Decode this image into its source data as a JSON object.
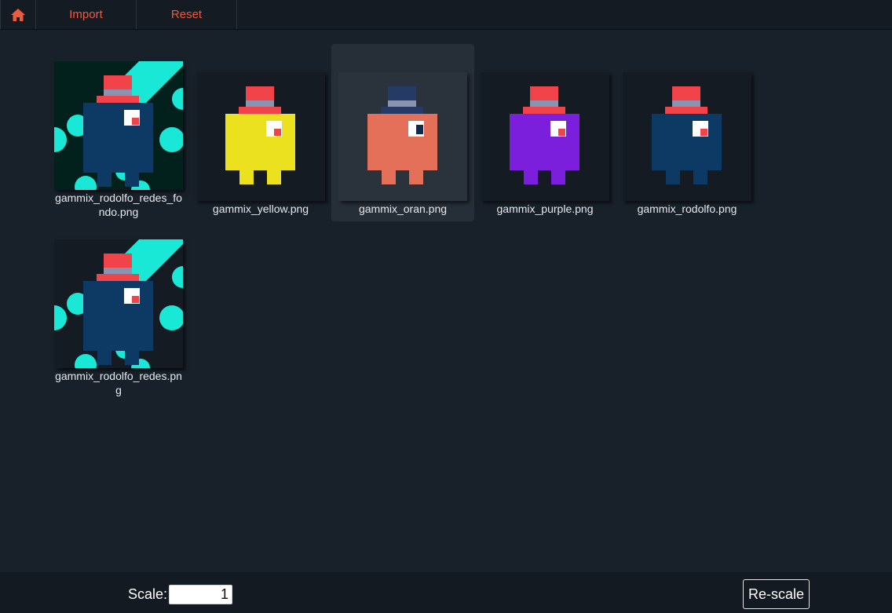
{
  "toolbar": {
    "home_icon": "home-icon",
    "import_label": "Import",
    "reset_label": "Reset",
    "accent_color": "#ee5a41"
  },
  "images": [
    {
      "caption": "gammix_rodolfo_redes_fondo.png",
      "body_color": "#0d3a64",
      "hat_color": "#f0434a",
      "selected": false,
      "background": "cyan-pattern-dark"
    },
    {
      "caption": "gammix_yellow.png",
      "body_color": "#ece11e",
      "hat_color": "#f0434a",
      "selected": false
    },
    {
      "caption": "gammix_oran.png",
      "body_color": "#e5705a",
      "hat_color": "#253a64",
      "selected": true
    },
    {
      "caption": "gammix_purple.png",
      "body_color": "#7b1fdd",
      "hat_color": "#f0434a",
      "selected": false
    },
    {
      "caption": "gammix_rodolfo.png",
      "body_color": "#0d3a64",
      "hat_color": "#f0434a",
      "selected": false
    },
    {
      "caption": "gammix_rodolfo_redes.png",
      "body_color": "#0d3a64",
      "hat_color": "#f0434a",
      "selected": false,
      "background": "cyan-pattern-light"
    }
  ],
  "bottom": {
    "scale_label": "Scale:",
    "scale_value": "1",
    "rescale_label": "Re-scale"
  }
}
